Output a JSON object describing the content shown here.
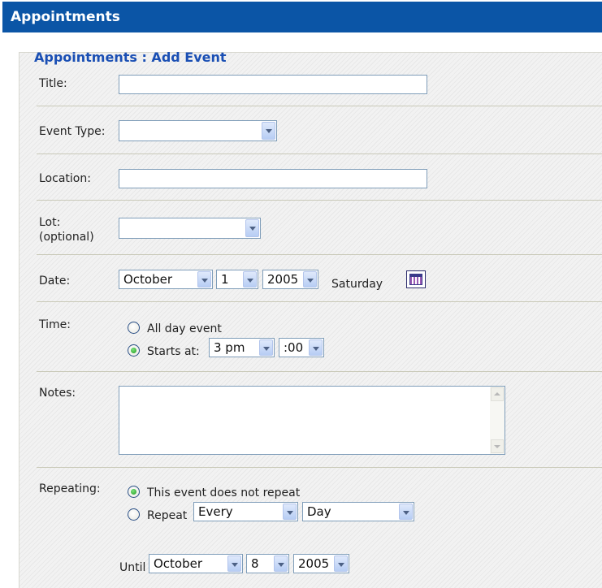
{
  "window_title": "Appointments",
  "form_heading": "Appointments : Add Event",
  "fields": {
    "title": {
      "label": "Title:",
      "value": ""
    },
    "event_type": {
      "label": "Event Type:",
      "value": ""
    },
    "location": {
      "label": "Location:",
      "value": ""
    },
    "lot": {
      "label": "Lot:",
      "sublabel": "(optional)",
      "value": ""
    },
    "date": {
      "label": "Date:",
      "month": "October",
      "day": "1",
      "year": "2005",
      "weekday": "Saturday"
    },
    "time": {
      "label": "Time:",
      "all_day_label": "All day event",
      "starts_at_label": "Starts at:",
      "hour": "3 pm",
      "minute": ":00",
      "selected": "starts_at"
    },
    "notes": {
      "label": "Notes:",
      "value": ""
    },
    "repeating": {
      "label": "Repeating:",
      "no_repeat_label": "This event does not repeat",
      "repeat_label": "Repeat",
      "frequency": "Every",
      "unit": "Day",
      "until_label": "Until",
      "until_month": "October",
      "until_day": "8",
      "until_year": "2005",
      "selected": "no_repeat"
    }
  },
  "icons": {
    "calendar": "calendar-icon",
    "dropdown": "chevron-down-icon"
  },
  "colors": {
    "titlebar": "#0b55a6",
    "heading": "#1a4fb4",
    "radio_selected": "#1c9a1c"
  }
}
